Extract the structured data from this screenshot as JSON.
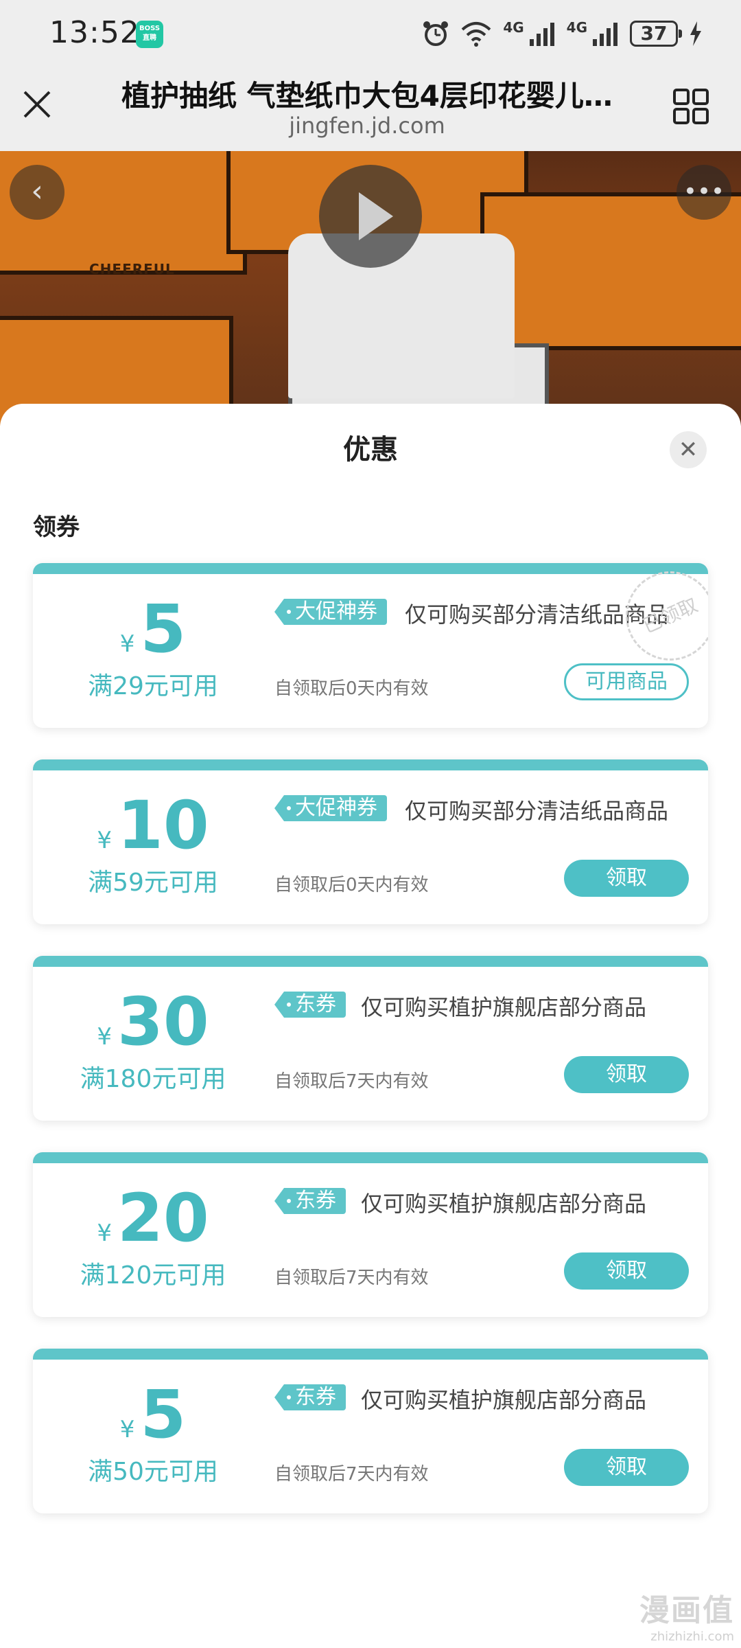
{
  "status": {
    "time": "13:52",
    "app_badge": "BOSS直聘",
    "battery": "37",
    "net1": "4G",
    "net2": "4G"
  },
  "header": {
    "title": "植护抽纸 气垫纸巾大包4层印花婴儿…",
    "url": "jingfen.jd.com"
  },
  "product": {
    "brand_on_box": "CHEERFUL"
  },
  "sheet": {
    "title": "优惠",
    "section": "领券",
    "coupons": [
      {
        "currency": "¥",
        "amount": "5",
        "condition": "满29元可用",
        "tag": "大促神券",
        "desc": "仅可购买部分清洁纸品商品",
        "validity": "自领取后0天内有效",
        "action": "可用商品",
        "stamp": "已领取"
      },
      {
        "currency": "¥",
        "amount": "10",
        "condition": "满59元可用",
        "tag": "大促神券",
        "desc": "仅可购买部分清洁纸品商品",
        "validity": "自领取后0天内有效",
        "action": "领取"
      },
      {
        "currency": "¥",
        "amount": "30",
        "condition": "满180元可用",
        "tag": "东券",
        "desc": "仅可购买植护旗舰店部分商品",
        "validity": "自领取后7天内有效",
        "action": "领取"
      },
      {
        "currency": "¥",
        "amount": "20",
        "condition": "满120元可用",
        "tag": "东券",
        "desc": "仅可购买植护旗舰店部分商品",
        "validity": "自领取后7天内有效",
        "action": "领取"
      },
      {
        "currency": "¥",
        "amount": "5",
        "condition": "满50元可用",
        "tag": "东券",
        "desc": "仅可购买植护旗舰店部分商品",
        "validity": "自领取后7天内有效",
        "action": "领取"
      }
    ]
  },
  "watermark": {
    "main": "漫画值",
    "sub": "zhizhizhi.com"
  },
  "colors": {
    "accent": "#5ec5c9",
    "accent_text": "#46b9bf"
  }
}
